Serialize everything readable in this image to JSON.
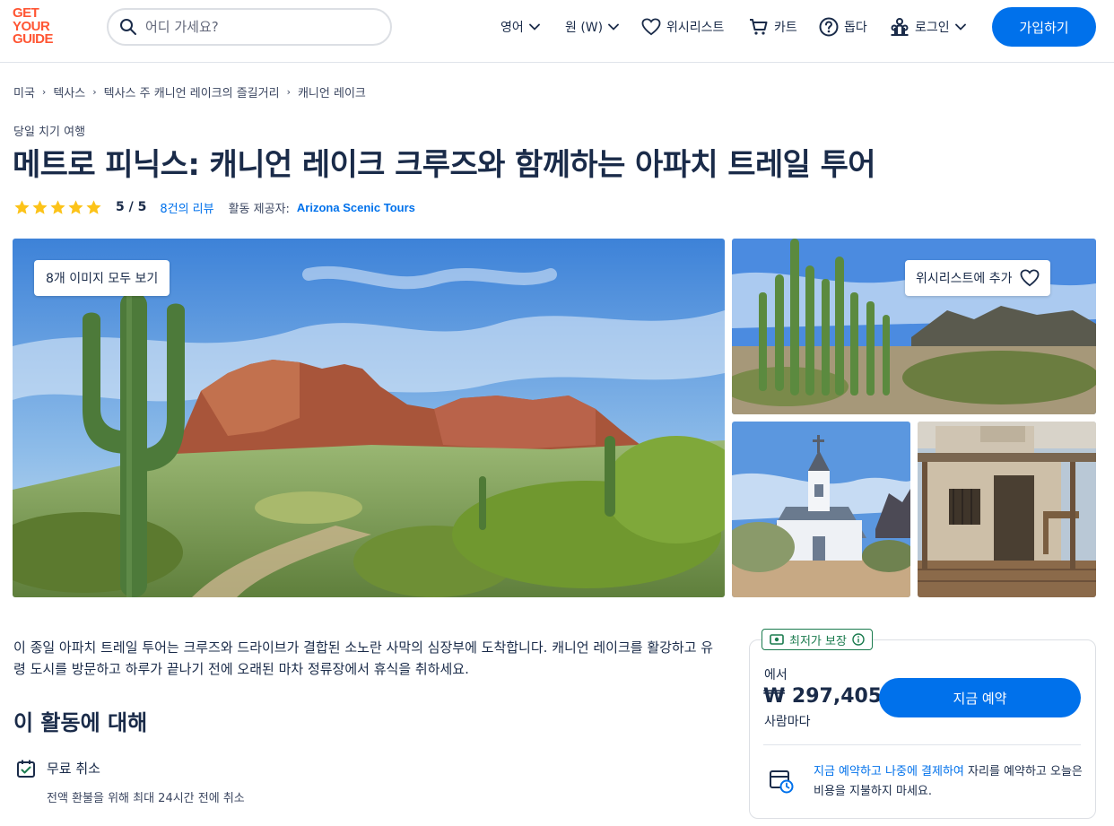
{
  "header": {
    "logo": [
      "GET",
      "YOUR",
      "GUIDE"
    ],
    "search_placeholder": "어디 가세요?",
    "language": "영어",
    "currency": "원 (W)",
    "wishlist": "위시리스트",
    "cart": "카트",
    "help": "돕다",
    "login": "로그인",
    "signup": "가입하기"
  },
  "breadcrumb": [
    "미국",
    "텍사스",
    "텍사스 주 캐니언 레이크의 즐길거리",
    "캐니언 레이크"
  ],
  "category": "당일 치기 여행",
  "title": "메트로 피닉스: 캐니언 레이크 크루즈와 함께하는 아파치 트레일 투어",
  "rating": {
    "stars": 5,
    "value": "5 / 5",
    "reviews": "8건의 리뷰",
    "provider_label": "활동 제공자:",
    "provider": "Arizona Scenic Tours"
  },
  "gallery": {
    "view_all": "8개 이미지 모두 보기",
    "add_wishlist": "위시리스트에 추가"
  },
  "intro": "이 종일 아파치 트레일 투어는 크루즈와 드라이브가 결합된 소노란 사막의 심장부에 도착합니다. 캐니언 레이크를 활강하고 유령 도시를 방문하고 하루가 끝나기 전에 오래된 마차 정류장에서 휴식을 취하세요.",
  "about": {
    "title": "이 활동에 대해",
    "feature_title": "무료 취소",
    "feature_desc": "전액 환불을 위해 최대 24시간 전에 취소"
  },
  "booking": {
    "best_price": "최저가 보장",
    "from": "에서",
    "price": "₩ 297,405",
    "per_person": "사람마다",
    "book_now": "지금 예약",
    "reserve_link": "지금 예약하고 나중에 결제하여",
    "reserve_rest": " 자리를 예약하고 오늘은 비용을 지불하지 마세요."
  },
  "colors": {
    "brand": "#ff5533",
    "accent": "#0071eb",
    "text": "#1a2b49",
    "star": "#fcc319",
    "guarantee": "#1b7b4e"
  }
}
